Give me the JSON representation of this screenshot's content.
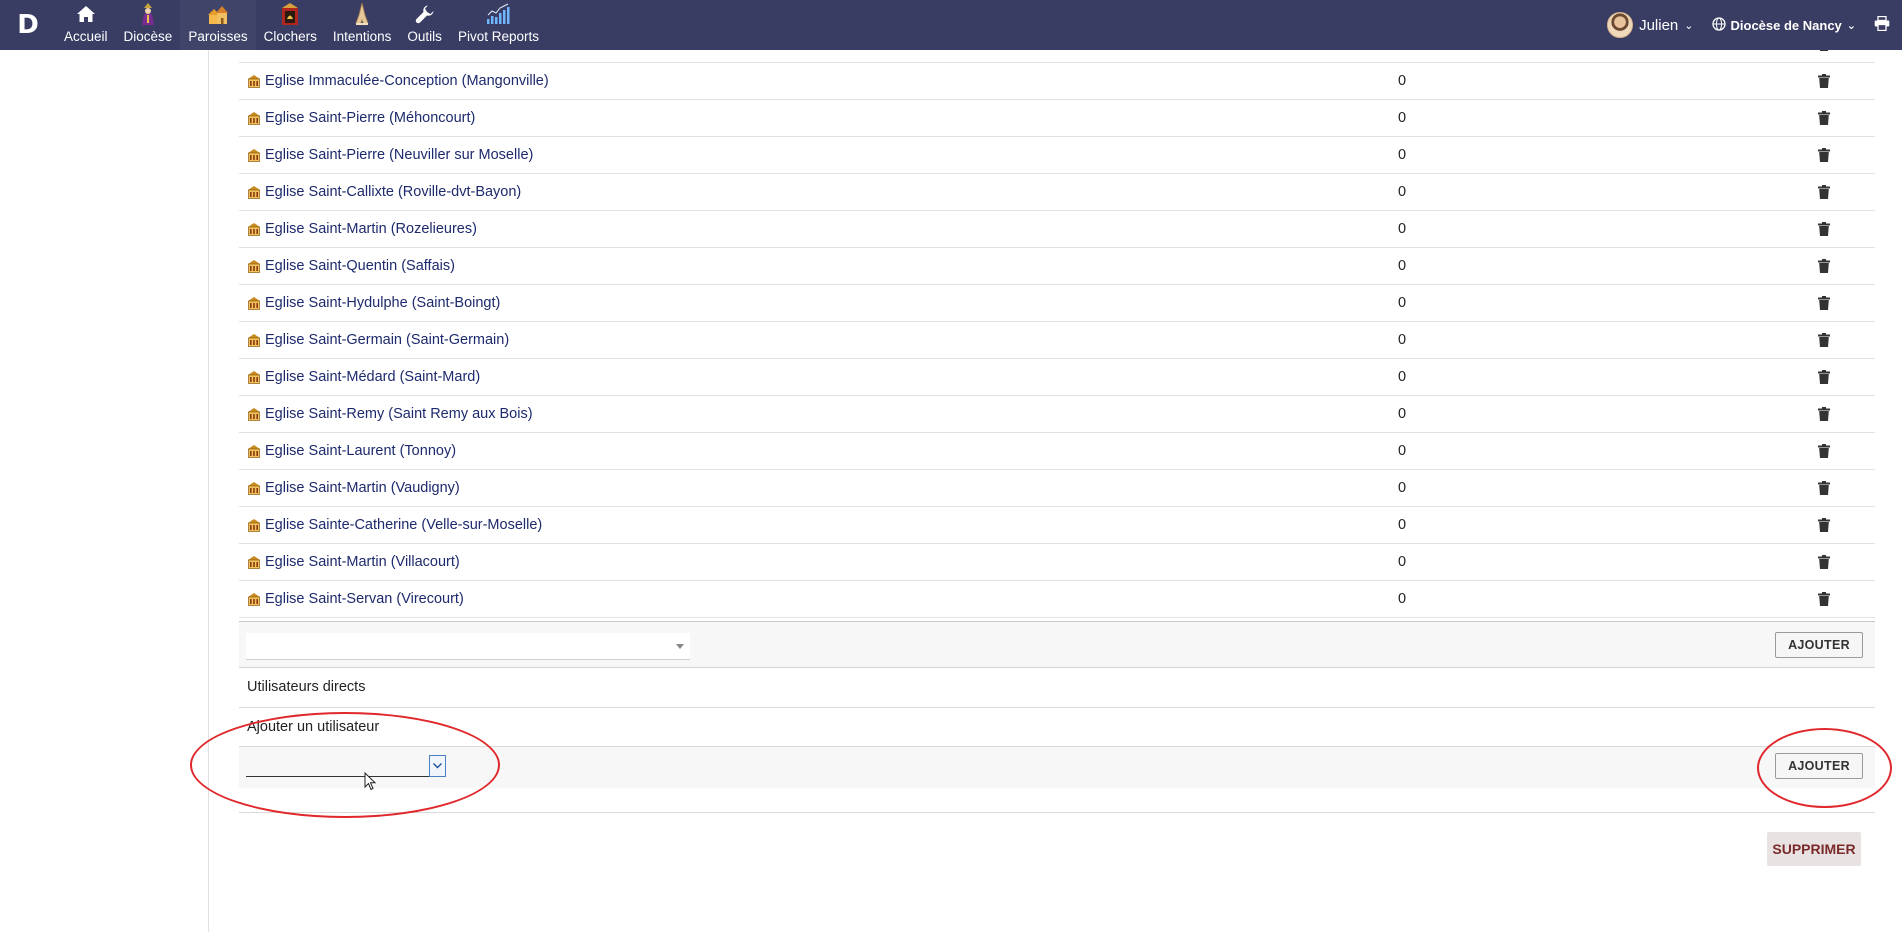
{
  "topbar": {
    "logo": "D",
    "nav": [
      {
        "label": "Accueil",
        "icon": "home-icon"
      },
      {
        "label": "Diocèse",
        "icon": "bishop-icon"
      },
      {
        "label": "Paroisses",
        "icon": "churches-icon"
      },
      {
        "label": "Clochers",
        "icon": "bell-tower-icon"
      },
      {
        "label": "Intentions",
        "icon": "praying-hands-icon"
      },
      {
        "label": "Outils",
        "icon": "wrench-icon"
      },
      {
        "label": "Pivot Reports",
        "icon": "bar-chart-icon"
      }
    ],
    "active_nav": "Paroisses",
    "user_name": "Julien",
    "diocese_name": "Diocèse de Nancy"
  },
  "churches": [
    {
      "name": "Eglise Immaculée-Conception (Mangonville)",
      "count": "0"
    },
    {
      "name": "Eglise Saint-Pierre (Méhoncourt)",
      "count": "0"
    },
    {
      "name": "Eglise Saint-Pierre (Neuviller sur Moselle)",
      "count": "0"
    },
    {
      "name": "Eglise Saint-Callixte (Roville-dvt-Bayon)",
      "count": "0"
    },
    {
      "name": "Eglise Saint-Martin (Rozelieures)",
      "count": "0"
    },
    {
      "name": "Eglise Saint-Quentin (Saffais)",
      "count": "0"
    },
    {
      "name": "Eglise Saint-Hydulphe (Saint-Boingt)",
      "count": "0"
    },
    {
      "name": "Eglise Saint-Germain (Saint-Germain)",
      "count": "0"
    },
    {
      "name": "Eglise Saint-Médard (Saint-Mard)",
      "count": "0"
    },
    {
      "name": "Eglise Saint-Remy (Saint Remy aux Bois)",
      "count": "0"
    },
    {
      "name": "Eglise Saint-Laurent (Tonnoy)",
      "count": "0"
    },
    {
      "name": "Eglise Saint-Martin (Vaudigny)",
      "count": "0"
    },
    {
      "name": "Eglise Sainte-Catherine (Velle-sur-Moselle)",
      "count": "0"
    },
    {
      "name": "Eglise Saint-Martin (Villacourt)",
      "count": "0"
    },
    {
      "name": "Eglise Saint-Servan (Virecourt)",
      "count": "0"
    }
  ],
  "partial_row": {
    "count": "0"
  },
  "add_church": {
    "selected": "",
    "button": "AJOUTER"
  },
  "direct_users": {
    "title": "Utilisateurs directs",
    "add_label": "Ajouter un utilisateur",
    "selected": "",
    "button": "AJOUTER"
  },
  "delete_button": "SUPPRIMER",
  "colors": {
    "topbar": "#3a3d63",
    "link": "#1d2a6d",
    "annotation": "#e0282c"
  }
}
